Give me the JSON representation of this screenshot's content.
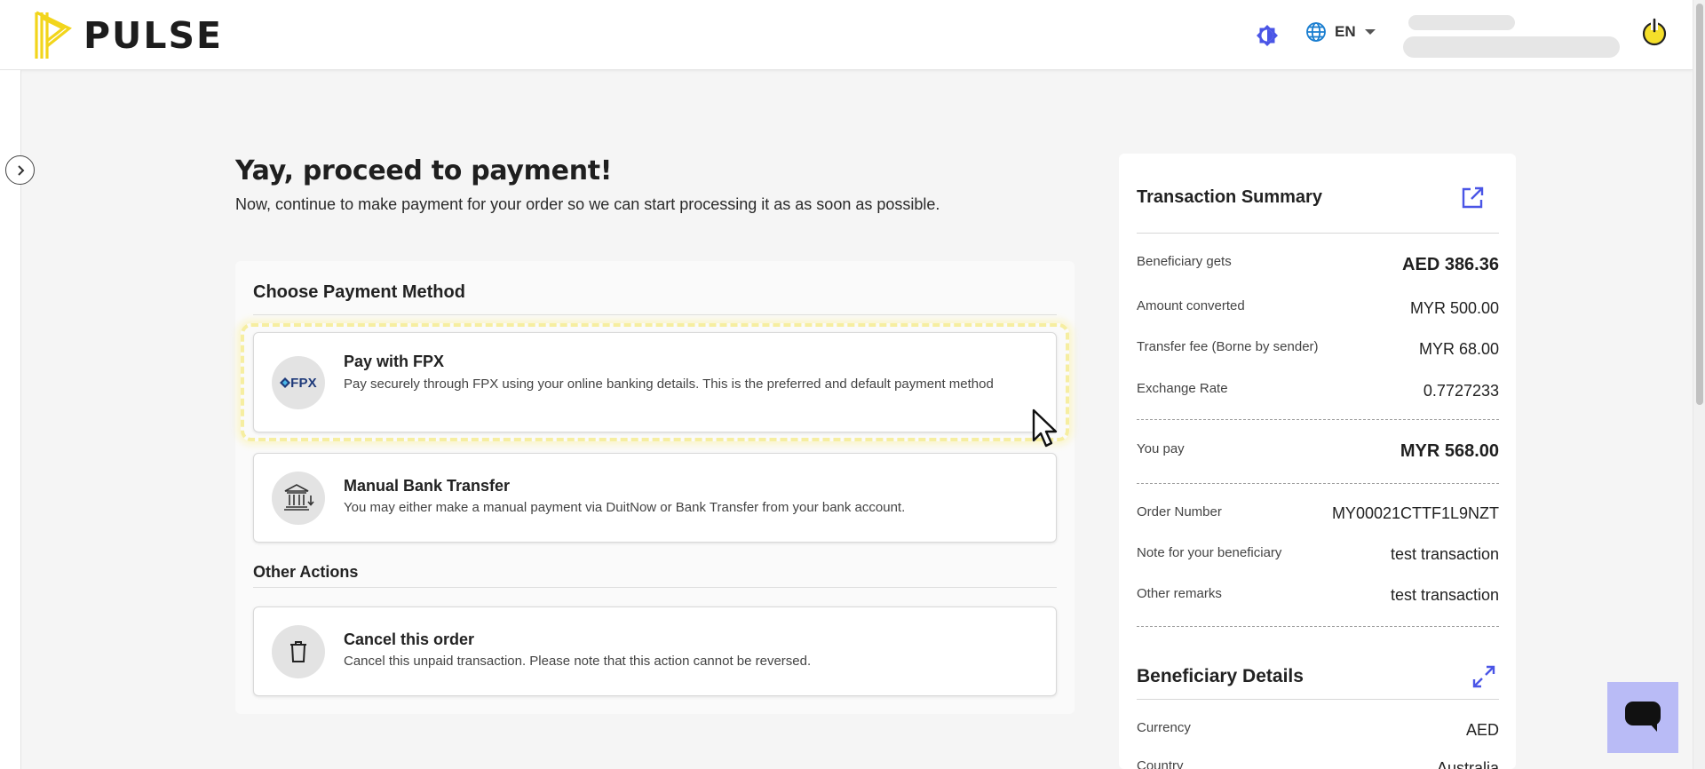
{
  "header": {
    "brand": "PULSE",
    "language": "EN",
    "brand_color": "#f2d51b",
    "theme_icon": "theme-toggle-icon",
    "globe_icon": "globe-icon",
    "power_icon": "power-icon"
  },
  "page": {
    "title": "Yay, proceed to payment!",
    "subtitle": "Now, continue to make payment for your order so we can start processing it as as soon as possible."
  },
  "payment": {
    "section_title": "Choose Payment Method",
    "options": [
      {
        "title": "Pay with FPX",
        "description": "Pay securely through FPX using your online banking details. This is the preferred and default payment method",
        "icon": "fpx-logo",
        "icon_text": "FPX"
      },
      {
        "title": "Manual Bank Transfer",
        "description": "You may either make a manual payment via DuitNow or Bank Transfer from your bank account.",
        "icon": "bank-icon"
      }
    ],
    "other_title": "Other Actions",
    "cancel": {
      "title": "Cancel this order",
      "description": "Cancel this unpaid transaction. Please note that this action cannot be reversed.",
      "icon": "trash-icon"
    }
  },
  "summary": {
    "title": "Transaction Summary",
    "rows": [
      {
        "label": "Beneficiary gets",
        "value": "AED 386.36"
      },
      {
        "label": "Amount converted",
        "value": "MYR 500.00"
      },
      {
        "label": "Transfer fee (Borne by sender)",
        "value": "MYR 68.00"
      },
      {
        "label": "Exchange Rate",
        "value": "0.7727233"
      },
      {
        "label": "You pay",
        "value": "MYR 568.00"
      },
      {
        "label": "Order Number",
        "value": "MY00021CTTF1L9NZT"
      },
      {
        "label": "Note for your beneficiary",
        "value": "test transaction"
      },
      {
        "label": "Other remarks",
        "value": "test transaction"
      }
    ]
  },
  "beneficiary": {
    "title": "Beneficiary Details",
    "rows": [
      {
        "label": "Currency",
        "value": "AED"
      },
      {
        "label": "Country",
        "value": "Australia"
      }
    ]
  },
  "colors": {
    "accent": "#4a55e6",
    "highlight": "#f6eea1",
    "chat_bg": "#b9bbf6"
  }
}
